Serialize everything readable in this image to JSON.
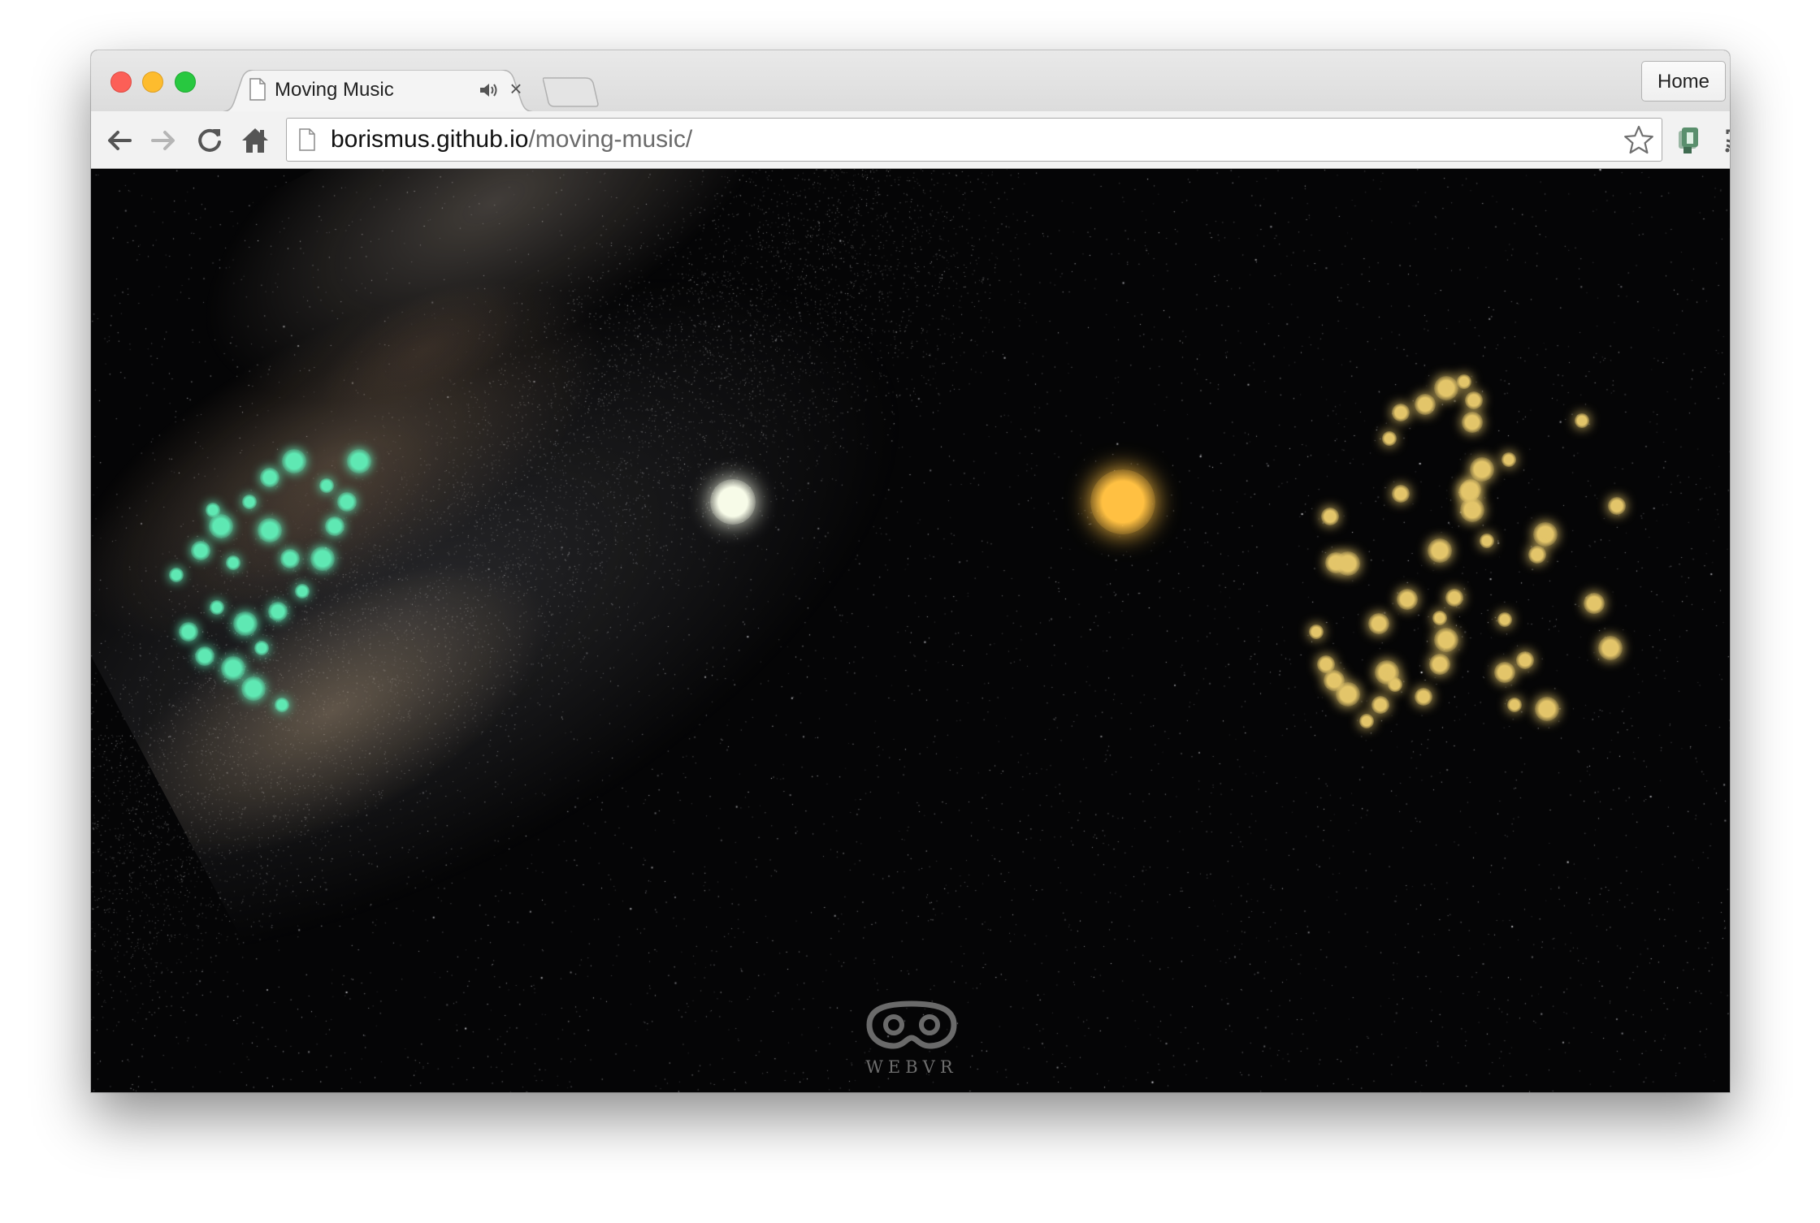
{
  "window": {
    "controls": [
      "close",
      "minimize",
      "zoom"
    ]
  },
  "tabs": [
    {
      "title": "Moving Music",
      "icon": "page-icon",
      "audio_playing": true,
      "close_label": "×"
    }
  ],
  "profile_button": {
    "label": "Home"
  },
  "toolbar": {
    "back_icon": "arrow-left-icon",
    "forward_icon": "arrow-right-icon",
    "reload_icon": "reload-icon",
    "home_icon": "home-icon",
    "menu_icon": "hamburger-menu-icon",
    "cast_icon": "cast-icon",
    "extension_icon": "extension-icon"
  },
  "omnibox": {
    "host": "borismus.github.io",
    "path": "/moving-music/",
    "bookmark_icon": "star-icon"
  },
  "content": {
    "scene": "space-background-with-milky-way",
    "logo_text": "WEBVR",
    "colors": {
      "green_particles": "#5fe8b3",
      "white_orb": "#f7fbe8",
      "orange_orb": "#ffc042",
      "gold_particles": "#e3c56a"
    }
  }
}
